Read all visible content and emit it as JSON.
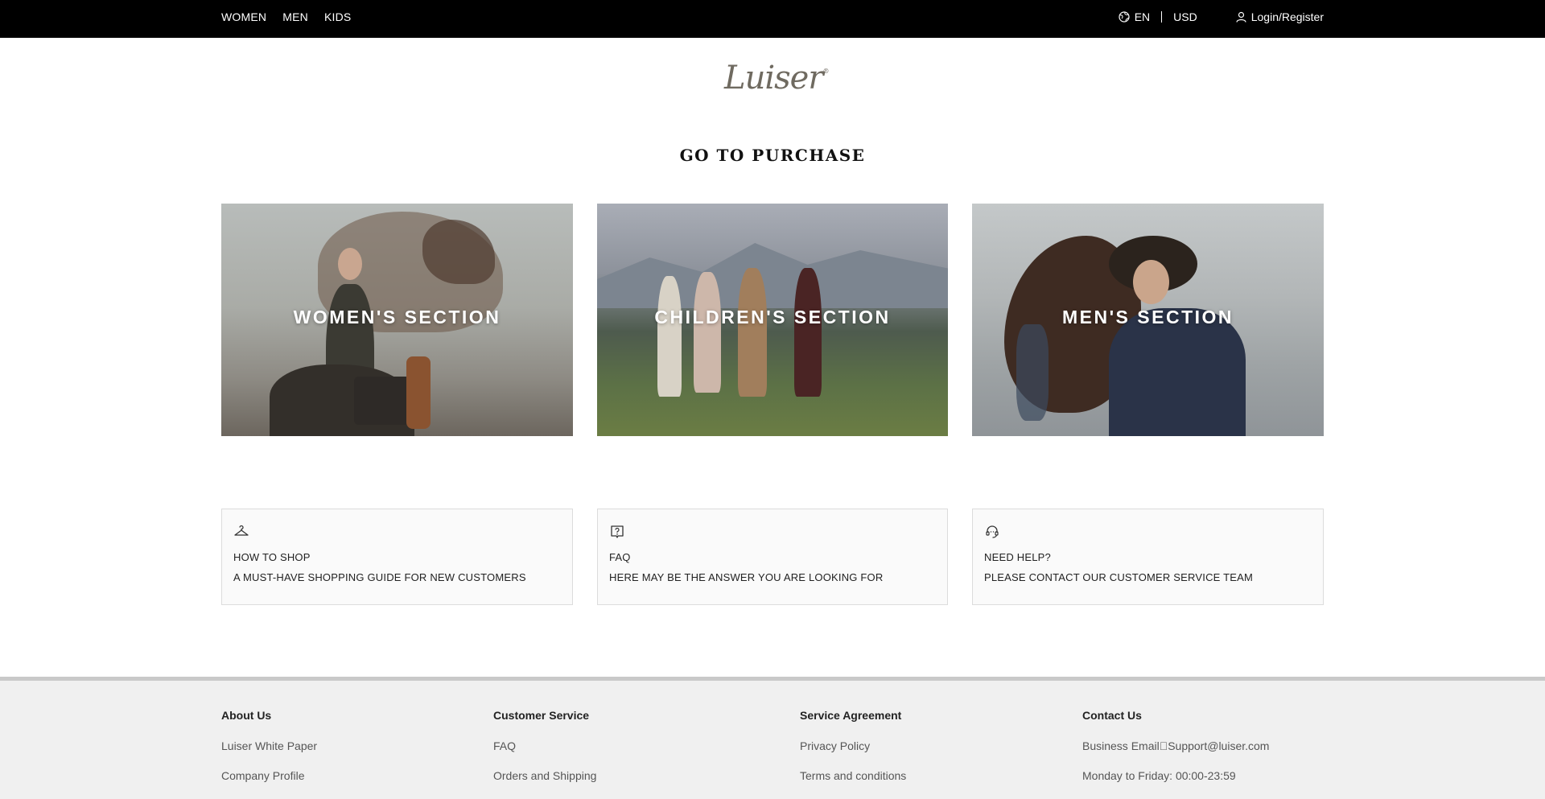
{
  "topbar": {
    "nav": [
      "WOMEN",
      "MEN",
      "KIDS"
    ],
    "language": "EN",
    "currency": "USD",
    "login": "Login/Register"
  },
  "brand": {
    "logo_text": "Luiser"
  },
  "page_title": "GO TO PURCHASE",
  "sections": [
    {
      "label": "WOMEN'S SECTION"
    },
    {
      "label": "CHILDREN'S SECTION"
    },
    {
      "label": "MEN'S SECTION"
    }
  ],
  "info_cards": [
    {
      "icon": "hanger-icon",
      "title": "HOW TO SHOP",
      "subtitle": "A MUST-HAVE SHOPPING GUIDE FOR NEW CUSTOMERS"
    },
    {
      "icon": "faq-icon",
      "title": "FAQ",
      "subtitle": "HERE MAY BE THE ANSWER YOU ARE LOOKING FOR"
    },
    {
      "icon": "headset-icon",
      "title": "NEED HELP?",
      "subtitle": "PLEASE CONTACT OUR CUSTOMER SERVICE TEAM"
    }
  ],
  "footer": {
    "about": {
      "heading": "About Us",
      "links": [
        "Luiser White Paper",
        "Company Profile"
      ]
    },
    "service": {
      "heading": "Customer Service",
      "links": [
        "FAQ",
        "Orders and Shipping"
      ]
    },
    "agreement": {
      "heading": "Service Agreement",
      "links": [
        "Privacy Policy",
        "Terms and conditions"
      ]
    },
    "contact": {
      "heading": "Contact Us",
      "lines": [
        "Business Email\u0000Support@luiser.com",
        "Monday to Friday: 00:00-23:59"
      ]
    }
  },
  "colors": {
    "topbar_bg": "#000000",
    "footer_bg": "#f0f0f0",
    "footer_border": "#c9c9c9"
  }
}
